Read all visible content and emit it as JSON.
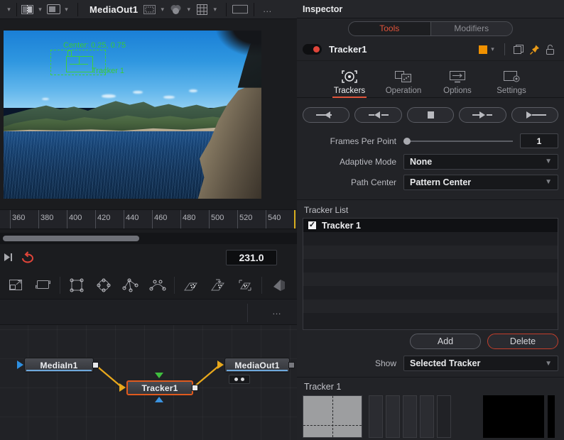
{
  "viewer_toolbar": {
    "title": "MediaOut1",
    "icons": [
      "split-view-icon",
      "chevron-down-icon",
      "single-view-icon",
      "chevron-down-icon",
      "roi-icon",
      "chevron-down-icon",
      "color-wheels-icon",
      "chevron-down-icon",
      "grid-icon",
      "chevron-down-icon",
      "frame-icon",
      "more-options-icon"
    ]
  },
  "viewer": {
    "tracker_center_label": "Center: 0.25, 0.75",
    "tracker_name_label": "Tracker 1",
    "overlay_color": "#39c83b"
  },
  "timeline": {
    "ticks": [
      "360",
      "380",
      "400",
      "420",
      "440",
      "460",
      "480",
      "500",
      "520",
      "540"
    ],
    "current_time": "231.0",
    "playhead_color": "#d8ae1f",
    "loop_color": "#e0453a"
  },
  "toolstrip": {
    "icons": [
      "fit-to-window-icon",
      "reset-transform-icon",
      "rectangle-mask-icon",
      "ellipse-mask-icon",
      "polygon-mask-icon",
      "bspline-mask-icon",
      "paint-stroke-icon",
      "paint-clone-icon",
      "paint-region-icon",
      "wipe-icon"
    ]
  },
  "node_graph": {
    "nodes": [
      {
        "name": "MediaIn1"
      },
      {
        "name": "Tracker1"
      },
      {
        "name": "MediaOut1"
      }
    ],
    "selected_node": "Tracker1",
    "selection_color": "#e05a1e",
    "link_color": "#e8a81c"
  },
  "inspector": {
    "title": "Inspector",
    "segments": [
      {
        "label": "Tools",
        "active": true
      },
      {
        "label": "Modifiers",
        "active": false
      }
    ],
    "active_segment_color": "#e0533a",
    "tool": {
      "name": "Tracker1",
      "enabled": true,
      "color_swatch": "#f09100",
      "icons": [
        "copy-icon",
        "pin-icon",
        "lock-icon",
        "chevron-down-icon"
      ]
    },
    "tabs": [
      {
        "label": "Trackers",
        "icon": "tracker-icon",
        "active": true
      },
      {
        "label": "Operation",
        "icon": "operation-icon",
        "active": false
      },
      {
        "label": "Options",
        "icon": "options-icon",
        "active": false
      },
      {
        "label": "Settings",
        "icon": "settings-icon",
        "active": false
      }
    ],
    "transport": [
      {
        "name": "track-reverse-button"
      },
      {
        "name": "step-back-button"
      },
      {
        "name": "stop-button"
      },
      {
        "name": "step-forward-button"
      },
      {
        "name": "track-forward-button"
      }
    ],
    "params": [
      {
        "label": "Frames Per Point",
        "type": "slider",
        "value": "1"
      },
      {
        "label": "Adaptive Mode",
        "type": "combo",
        "value": "None"
      },
      {
        "label": "Path Center",
        "type": "combo",
        "value": "Pattern Center"
      }
    ],
    "tracker_list": {
      "section_label": "Tracker List",
      "items": [
        {
          "name": "Tracker 1",
          "checked": true
        }
      ]
    },
    "buttons": {
      "add": "Add",
      "delete": "Delete",
      "delete_color": "#c33f2c"
    },
    "show": {
      "label": "Show",
      "value": "Selected Tracker"
    },
    "pattern": {
      "header": "Tracker 1"
    }
  }
}
